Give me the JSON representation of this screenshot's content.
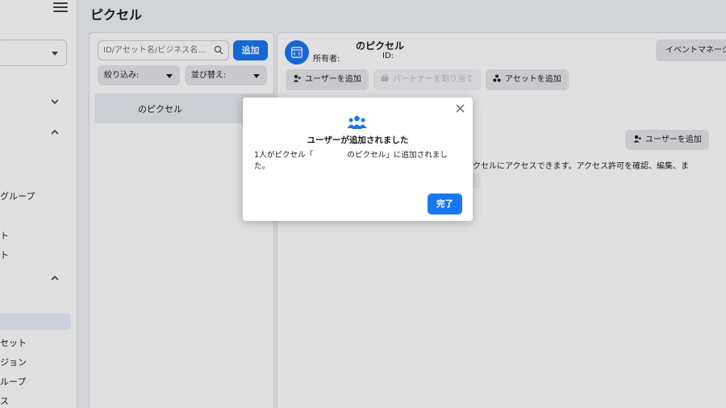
{
  "header": {
    "title": "ピクセル"
  },
  "sidebar": {
    "items": [
      {
        "label": "グループ"
      },
      {
        "label": "ト"
      },
      {
        "label": "ト"
      },
      {
        "label": "セット"
      },
      {
        "label": "ジョン"
      },
      {
        "label": "ループ"
      },
      {
        "label": "ス"
      }
    ]
  },
  "list": {
    "search_placeholder": "ID/アセット名/ビジネス名...",
    "add_label": "追加",
    "filter_label": "絞り込み:",
    "sort_label": "並び替え:",
    "items": [
      {
        "name": "のピクセル"
      }
    ]
  },
  "detail": {
    "pixel_name": "のピクセル",
    "owner_label": "所有者:",
    "id_label": "ID:",
    "event_manager_label": "イベントマネージ",
    "actions": {
      "add_user": "ユーザーを追加",
      "assign_partner": "パートナーを割り当て",
      "add_asset": "アセットを追加"
    },
    "add_user_secondary": "ユーザーを追加",
    "description": "のピクセルにアクセスできます。アクセス許可を確認、編集、ま"
  },
  "modal": {
    "title": "ユーザーが追加されました",
    "body_part1": "1人がピクセル「",
    "body_part2": "のピクセル」に追加されまし",
    "body_part3": "た。",
    "done_label": "完了"
  },
  "colors": {
    "accent": "#1877f2",
    "background": "#f0f2f5"
  }
}
